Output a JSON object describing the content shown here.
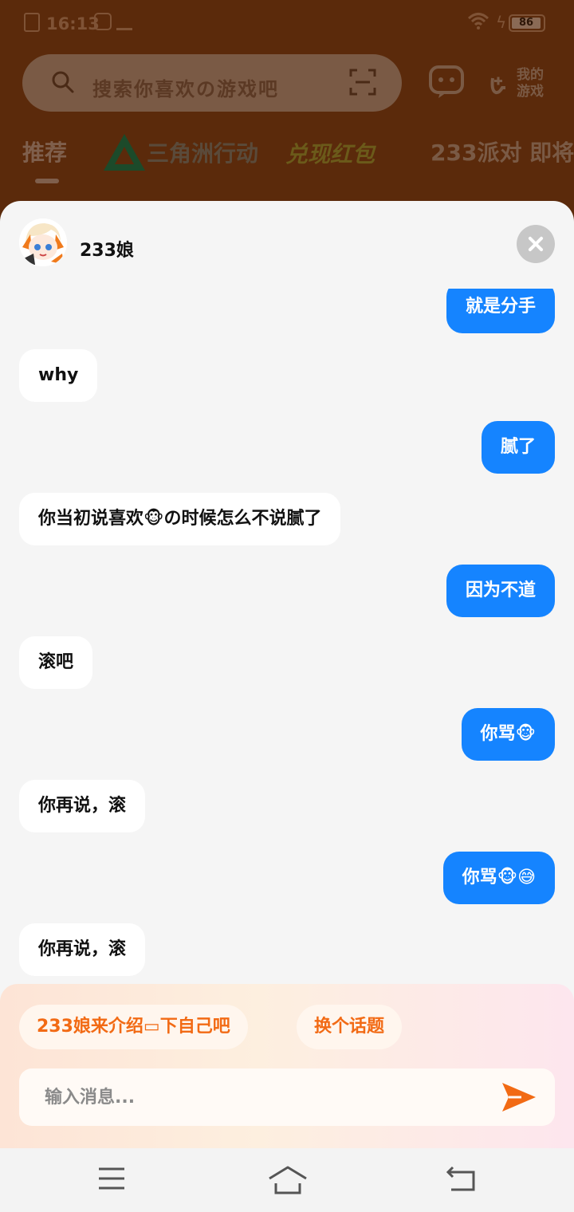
{
  "status_bar": {
    "time": "16:13",
    "battery": "86"
  },
  "search": {
    "placeholder": "搜索你喜欢の游戏吧"
  },
  "header": {
    "my_games_label": "我的\n游戏"
  },
  "tabs": [
    {
      "label": "推荐"
    },
    {
      "label": "三角洲行动"
    },
    {
      "label": "兑现红包"
    },
    {
      "label": "233派对 即将"
    }
  ],
  "chat": {
    "title": "233娘",
    "messages": [
      {
        "from": "me",
        "text": "就是分手"
      },
      {
        "from": "bot",
        "text": "why"
      },
      {
        "from": "me",
        "text": "腻了"
      },
      {
        "from": "bot",
        "text": "你当初说喜欢🐵の时候怎么不说腻了"
      },
      {
        "from": "me",
        "text": "因为不道"
      },
      {
        "from": "bot",
        "text": "滚吧"
      },
      {
        "from": "me",
        "text": "你骂🐵"
      },
      {
        "from": "bot",
        "text": "你再说，滚"
      },
      {
        "from": "me",
        "text": "你骂🐵😅"
      },
      {
        "from": "bot",
        "text": "你再说，滚"
      }
    ],
    "suggestions": [
      {
        "label": "233娘来介绍▭下自己吧"
      },
      {
        "label": "换个话题"
      }
    ],
    "input_placeholder": "输入消息..."
  },
  "colors": {
    "accent_blue": "#1584ff",
    "accent_orange": "#f26a14",
    "dim_background": "#5b2a0b"
  }
}
